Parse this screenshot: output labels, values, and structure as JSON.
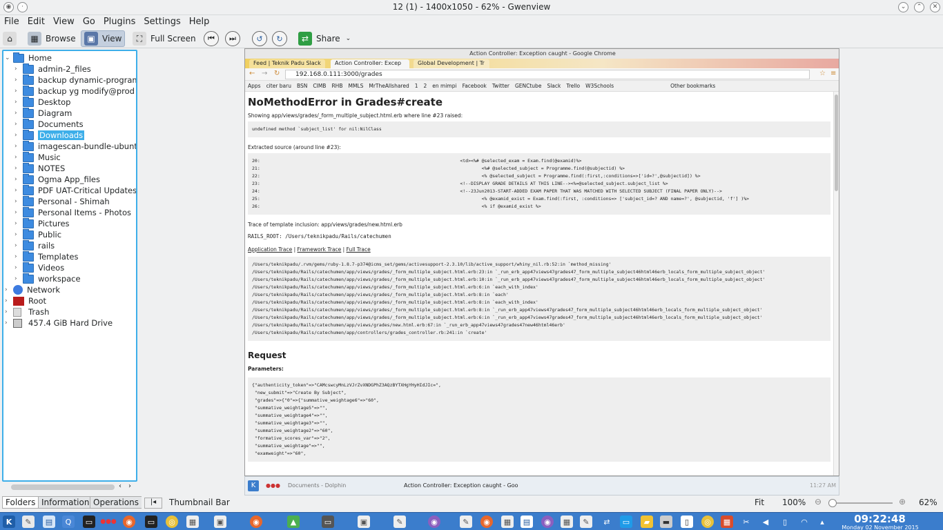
{
  "window": {
    "title": "12 (1) - 1400x1050 - 62% - Gwenview"
  },
  "menu": [
    "File",
    "Edit",
    "View",
    "Go",
    "Plugins",
    "Settings",
    "Help"
  ],
  "toolbar": {
    "browse": "Browse",
    "view": "View",
    "fullscreen": "Full Screen",
    "share": "Share"
  },
  "tree": {
    "home": "Home",
    "items": [
      "admin-2_files",
      "backup dynamic-programm",
      "backup yg modify@prod",
      "Desktop",
      "Diagram",
      "Documents",
      "Downloads",
      "imagescan-bundle-ubuntu",
      "Music",
      "NOTES",
      "Ogma App_files",
      "PDF UAT-Critical Updates",
      "Personal - Shimah",
      "Personal Items - Photos",
      "Pictures",
      "Public",
      "rails",
      "Templates",
      "Videos",
      "workspace"
    ],
    "network": "Network",
    "root": "Root",
    "trash": "Trash",
    "drive": "457.4 GiB Hard Drive"
  },
  "side_tabs": [
    "Folders",
    "Information",
    "Operations"
  ],
  "statusbar": {
    "thumbnail": "Thumbnail Bar",
    "fit": "Fit",
    "zoom_100": "100%",
    "zoom": "62%"
  },
  "browser": {
    "window_title": "Action Controller: Exception caught - Google Chrome",
    "tabs": [
      "Feed | Teknik Padu Slack",
      "Action Controller: Excep",
      "Global Development | Tr"
    ],
    "url": "192.168.0.111:3000/grades",
    "bookmarks": [
      "Apps",
      "citer baru",
      "BSN",
      "CIMB",
      "RHB",
      "MMLS",
      "MrTheAllshared",
      "1",
      "2",
      "en mimpi",
      "Facebook",
      "Twitter",
      "GENCtube",
      "Slack",
      "Trello",
      "W3Schools",
      "Other bookmarks"
    ],
    "heading": "NoMethodError in Grades#create",
    "showing": "Showing app/views/grades/_form_multiple_subject.html.erb where line #23 raised:",
    "error_msg": "undefined method `subject_list' for nil:NilClass",
    "extracted": "Extracted source (around line #23):",
    "source": "20:                                                                          <td><%# @selected_exam = Exam.find(@examid)%>\n21:                                                                                  <%# @selected_subject = Programme.find(@subjectid) %>\n22:                                                                                  <% @selected_subject = Programme.find(:first,:conditions=>['id=?',@subjectid]) %>\n23:                                                                          <!--DISPLAY GRADE DETAILS AT THIS LINE--><%=@selected_subject.subject_list %>\n24:                                                                          <!--23Jun2013-START-ADDED EXAM PAPER THAT WAS MATCHED WITH SELECTED SUBJECT (FINAL PAPER ONLY)-->\n25:                                                                                  <% @examid_exist = Exam.find(:first, :conditions=> ['subject_id=? AND name=?', @subjectid, 'f'] )%>\n26:                                                                                  <% if @examid_exist %>",
    "trace_inclusion": "Trace of template inclusion: app/views/grades/new.html.erb",
    "rails_root": "RAILS_ROOT: /Users/teknikpadu/Rails/catechumen",
    "trace_links": [
      "Application Trace",
      "Framework Trace",
      "Full Trace"
    ],
    "trace": "/Users/teknikpadu/.rvm/gems/ruby-1.8.7-p374@icms_set/gems/activesupport-2.3.10/lib/active_support/whiny_nil.rb:52:in `method_missing'\n/Users/teknikpadu/Rails/catechumen/app/views/grades/_form_multiple_subject.html.erb:23:in `_run_erb_app47views47grades47_form_multiple_subject46html46erb_locals_form_multiple_subject_object'\n/Users/teknikpadu/Rails/catechumen/app/views/grades/_form_multiple_subject.html.erb:10:in `_run_erb_app47views47grades47_form_multiple_subject46html46erb_locals_form_multiple_subject_object'\n/Users/teknikpadu/Rails/catechumen/app/views/grades/_form_multiple_subject.html.erb:6:in `each_with_index'\n/Users/teknikpadu/Rails/catechumen/app/views/grades/_form_multiple_subject.html.erb:8:in `each'\n/Users/teknikpadu/Rails/catechumen/app/views/grades/_form_multiple_subject.html.erb:8:in `each_with_index'\n/Users/teknikpadu/Rails/catechumen/app/views/grades/_form_multiple_subject.html.erb:8:in `_run_erb_app47views47grades47_form_multiple_subject46html46erb_locals_form_multiple_subject_object'\n/Users/teknikpadu/Rails/catechumen/app/views/grades/_form_multiple_subject.html.erb:6:in `_run_erb_app47views47grades47_form_multiple_subject46html46erb_locals_form_multiple_subject_object'\n/Users/teknikpadu/Rails/catechumen/app/views/grades/new.html.erb:67:in `_run_erb_app47views47grades47new46html46erb'\n/Users/teknikpadu/Rails/catechumen/app/controllers/grades_controller.rb:241:in `create'",
    "request_heading": "Request",
    "parameters_label": "Parameters:",
    "parameters": "{\"authenticity_token\"=>\"CAMcswcyMnLzVJrZvXNDGPhZ3AQzBYTXHgYHyHIdJIc=\",\n \"new_submit\"=>\"Create By Subject\",\n \"grades\"=>{\"0\"=>{\"summative_weightage6\"=>\"60\",\n \"summative_weightage5\"=>\"\",\n \"summative_weightage4\"=>\"\",\n \"summative_weightage3\"=>\"\",\n \"summative_weightage2\"=>\"60\",\n \"formative_scores_var\"=>\"2\",\n \"summative_weightage\"=>\"\",\n \"examweight\"=>\"60\",",
    "taskbar": [
      "Documents - Dolphin",
      "Action Controller: Exception caught - Goo"
    ],
    "time": "11:27 AM"
  },
  "taskbar": {
    "clock": "09:22:48",
    "date": "Monday 02 November 2015"
  }
}
